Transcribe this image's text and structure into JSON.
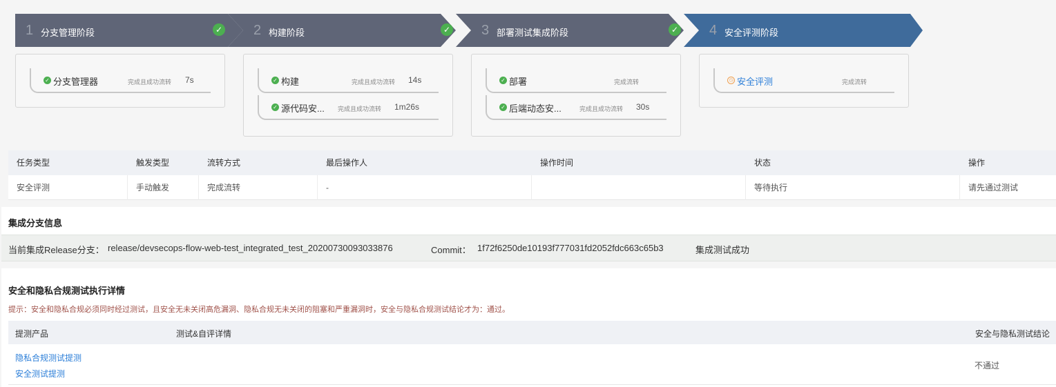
{
  "stages": [
    {
      "num": "1",
      "title": "分支管理阶段",
      "done": true,
      "color": "#5f6577"
    },
    {
      "num": "2",
      "title": "构建阶段",
      "done": true,
      "color": "#5f6577"
    },
    {
      "num": "3",
      "title": "部署测试集成阶段",
      "done": true,
      "color": "#5f6577"
    },
    {
      "num": "4",
      "title": "安全评测阶段",
      "done": false,
      "color": "#3f6b9b"
    }
  ],
  "jobs": {
    "stage1": [
      {
        "name": "分支管理器",
        "status": "完成且成功流转",
        "duration": "7s"
      }
    ],
    "stage2": [
      {
        "name": "构建",
        "status": "完成且成功流转",
        "duration": "14s"
      },
      {
        "name": "源代码安...",
        "status": "完成且成功流转",
        "duration": "1m26s"
      }
    ],
    "stage3": [
      {
        "name": "部署",
        "status": "完成流转",
        "duration": ""
      },
      {
        "name": "后端动态安...",
        "status": "完成且成功流转",
        "duration": "30s"
      }
    ],
    "stage4": [
      {
        "name": "安全评测",
        "status": "完成流转",
        "duration": ""
      }
    ]
  },
  "task_table": {
    "headers": [
      "任务类型",
      "触发类型",
      "流转方式",
      "最后操作人",
      "操作时间",
      "状态",
      "操作"
    ],
    "row": [
      "安全评测",
      "手动触发",
      "完成流转",
      "-",
      "",
      "等待执行",
      "请先通过测试"
    ]
  },
  "branch": {
    "title": "集成分支信息",
    "release_label": "当前集成Release分支：",
    "release_value": "release/devsecops-flow-web-test_integrated_test_20200730093033876",
    "commit_label": "Commit：",
    "commit_value": "1f72f6250de10193f777031fd2052fdc663c65b3",
    "result": "集成测试成功"
  },
  "security": {
    "title": "安全和隐私合规测试执行详情",
    "tip": "提示：安全和隐私合规必须同时经过测试，且安全无未关闭高危漏洞、隐私合规无未关闭的阻塞和严重漏洞时，安全与隐私合规测试结论才为：通过。",
    "headers": [
      "提测产品",
      "测试&自评详情",
      "安全与隐私测试结论"
    ],
    "links": [
      "隐私合规测试提测",
      "安全测试提测"
    ],
    "result": "不通过"
  },
  "colors": {
    "success": "#4caf50",
    "link": "#2d7fd8",
    "warning": "#f0a050",
    "tip": "#a0524a"
  }
}
